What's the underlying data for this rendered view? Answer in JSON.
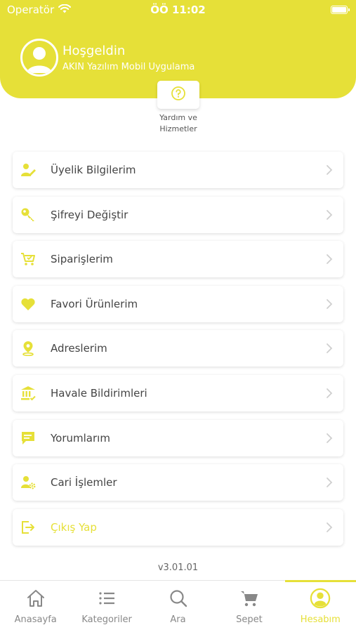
{
  "statusbar": {
    "carrier": "Operatör",
    "time": "ÖÖ 11:02"
  },
  "header": {
    "title": "Hoşgeldin",
    "subtitle": "AKIN Yazılım Mobil Uygulama",
    "background": "#e6e038"
  },
  "help": {
    "line1": "Yardım ve",
    "line2": "Hizmetler",
    "icon": "question-circle-icon"
  },
  "menu": {
    "items": [
      {
        "label": "Üyelik Bilgilerim",
        "icon": "user-edit-icon"
      },
      {
        "label": "Şifreyi Değiştir",
        "icon": "key-icon"
      },
      {
        "label": "Siparişlerim",
        "icon": "cart-check-icon"
      },
      {
        "label": "Favori Ürünlerim",
        "icon": "heart-icon"
      },
      {
        "label": "Adreslerim",
        "icon": "location-pin-icon"
      },
      {
        "label": "Havale Bildirimleri",
        "icon": "bank-icon"
      },
      {
        "label": "Yorumlarım",
        "icon": "comment-icon"
      },
      {
        "label": "Cari İşlemler",
        "icon": "user-gear-icon"
      },
      {
        "label": "Çıkış Yap",
        "icon": "logout-icon"
      }
    ]
  },
  "version": "v3.01.01",
  "tabs": [
    {
      "label": "Anasayfa",
      "icon": "home-icon"
    },
    {
      "label": "Kategoriler",
      "icon": "list-icon"
    },
    {
      "label": "Ara",
      "icon": "search-icon"
    },
    {
      "label": "Sepet",
      "icon": "cart-icon"
    },
    {
      "label": "Hesabım",
      "icon": "account-icon",
      "active": true
    }
  ],
  "colors": {
    "accent": "#e6e038",
    "text": "#444444",
    "muted": "#888888"
  }
}
